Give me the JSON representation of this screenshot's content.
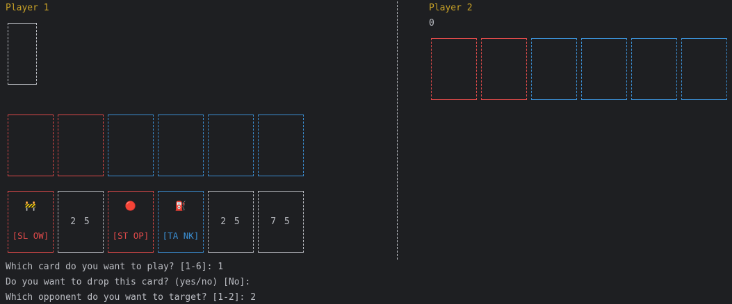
{
  "player1": {
    "title": "Player 1",
    "hand": [
      {
        "color": "red",
        "symbol": "🚧",
        "label": "[SL OW]"
      },
      {
        "color": "gray",
        "value": "2 5"
      },
      {
        "color": "red",
        "symbol": "🔴",
        "label": "[ST OP]"
      },
      {
        "color": "blue",
        "symbol": "⛽",
        "label": "[TA NK]"
      },
      {
        "color": "gray",
        "value": "2 5"
      },
      {
        "color": "gray",
        "value": "7 5"
      }
    ]
  },
  "player2": {
    "title": "Player 2",
    "score": "0"
  },
  "prompts": [
    "Which card do you want to play? [1-6]: 1",
    "Do you want to drop this card? (yes/no) [No]:",
    "Which opponent do you want to target? [1-2]: 2"
  ],
  "colors": {
    "red": "#e04a4a",
    "blue": "#3b8fd4",
    "gray": "#bcbec4",
    "title": "#c9a227",
    "background": "#1e1f22"
  }
}
